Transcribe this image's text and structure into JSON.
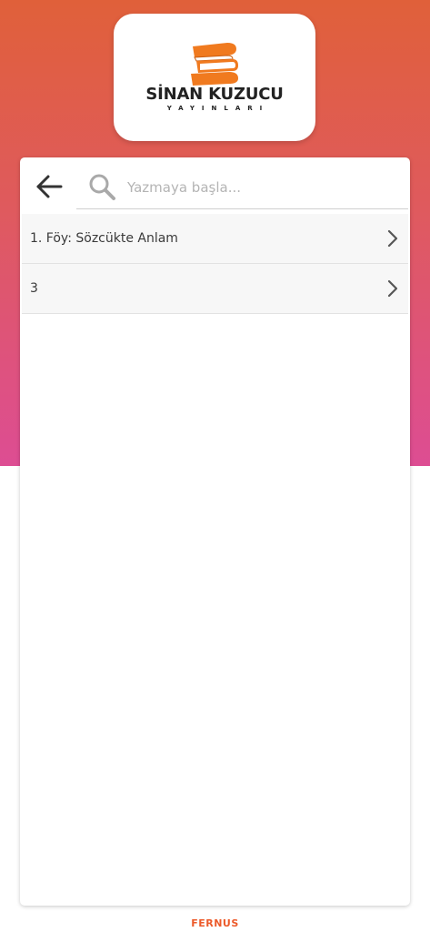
{
  "brand": {
    "name": "SİNAN KUZUCU",
    "subtitle": "YAYINLARI",
    "logo_icon": "stacked-books-icon",
    "accent_color": "#f07a1f"
  },
  "search": {
    "back_icon": "arrow-left-icon",
    "icon": "search-icon",
    "placeholder": "Yazmaya başla...",
    "value": ""
  },
  "list": {
    "items": [
      {
        "label": "1. Föy: Sözcükte Anlam",
        "icon": "chevron-right-icon"
      },
      {
        "label": "3",
        "icon": "chevron-right-icon"
      }
    ]
  },
  "footer": {
    "brand": "FERNUS",
    "color": "#ec5a2a"
  },
  "theme": {
    "gradient_top": "#e0603a",
    "gradient_bottom": "#dd4d93"
  }
}
